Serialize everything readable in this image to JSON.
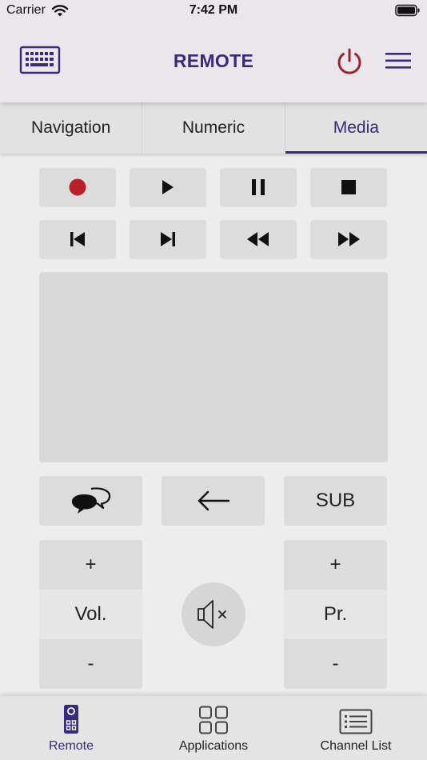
{
  "status_bar": {
    "carrier": "Carrier",
    "time": "7:42 PM"
  },
  "header": {
    "title": "REMOTE"
  },
  "tabs": [
    {
      "label": "Navigation",
      "active": false
    },
    {
      "label": "Numeric",
      "active": false
    },
    {
      "label": "Media",
      "active": true
    }
  ],
  "media_controls": {
    "row1": [
      "record-icon",
      "play-icon",
      "pause-icon",
      "stop-icon"
    ],
    "row2": [
      "skip-previous-icon",
      "skip-next-icon",
      "rewind-icon",
      "fast-forward-icon"
    ]
  },
  "function_buttons": {
    "subtitle_label": "SUB"
  },
  "volume": {
    "plus": "+",
    "label": "Vol.",
    "minus": "-"
  },
  "program": {
    "plus": "+",
    "label": "Pr.",
    "minus": "-"
  },
  "bottom_nav": [
    {
      "label": "Remote",
      "icon": "remote-icon",
      "active": true
    },
    {
      "label": "Applications",
      "icon": "apps-grid-icon",
      "active": false
    },
    {
      "label": "Channel List",
      "icon": "list-icon",
      "active": false
    }
  ],
  "colors": {
    "accent": "#3a2a7a",
    "power": "#9b2230",
    "record": "#b8202e"
  }
}
